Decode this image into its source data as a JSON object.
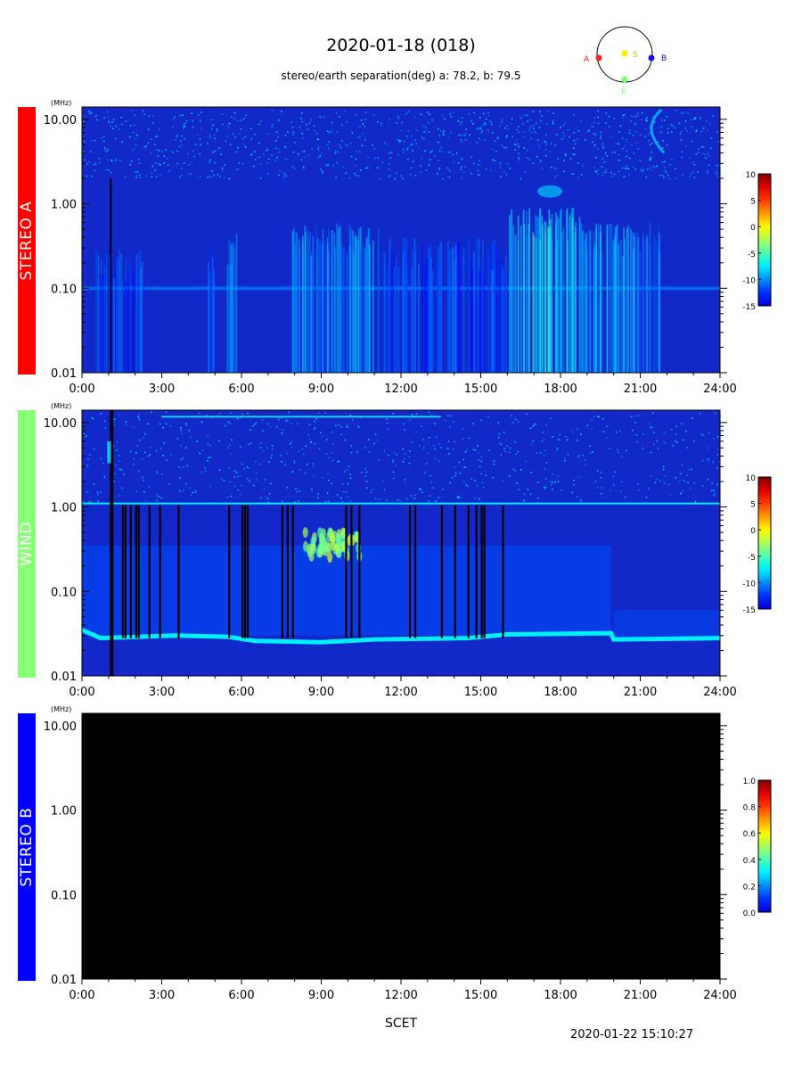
{
  "header": {
    "title": "2020-01-18 (018)",
    "subtitle": "stereo/earth separation(deg) a:  78.2, b:  79.5"
  },
  "orbit_diagram": {
    "labels": {
      "a": "A",
      "s": "S",
      "b": "B",
      "e": "E"
    },
    "colors": {
      "a": "#ff2020",
      "s": "#ffee00",
      "b": "#1010ff",
      "e": "#7dfa7d"
    }
  },
  "footer": {
    "xlabel": "SCET",
    "generated": "2020-01-22 15:10:27"
  },
  "colors": {
    "stereo_a": "#ff0000",
    "wind": "#88ff77",
    "stereo_b": "#0000ff",
    "background_spectrogram": "#1228c8",
    "no_data": "#000000"
  },
  "chart_data": [
    {
      "type": "heatmap",
      "name": "STEREO A",
      "y_unit": "(MHz)",
      "y_scale": "log",
      "ylim": [
        0.01,
        14
      ],
      "y_ticks": [
        "10.00",
        "1.00",
        "0.10",
        "0.01"
      ],
      "xlim": [
        0,
        24
      ],
      "x_ticks": [
        "0:00",
        "3:00",
        "6:00",
        "9:00",
        "12:00",
        "15:00",
        "18:00",
        "21:00",
        "24:00"
      ],
      "colorbar": {
        "min": -15,
        "max": 10,
        "ticks": [
          "10",
          "5",
          "0",
          "-5",
          "-10",
          "-15"
        ]
      },
      "bursts": [
        {
          "start": 0.5,
          "end": 2.3,
          "fmax": 0.3,
          "level": -8
        },
        {
          "start": 4.7,
          "end": 5.0,
          "fmax": 0.3,
          "level": -8
        },
        {
          "start": 5.4,
          "end": 5.8,
          "fmax": 0.45,
          "level": -6
        },
        {
          "start": 7.9,
          "end": 11.2,
          "fmax": 0.6,
          "level": -6
        },
        {
          "start": 11.2,
          "end": 16.0,
          "fmax": 0.4,
          "level": -8
        },
        {
          "start": 16.0,
          "end": 18.7,
          "fmax": 0.9,
          "level": -4
        },
        {
          "start": 18.7,
          "end": 21.9,
          "fmax": 0.6,
          "level": -6
        }
      ],
      "narrowband_line_mhz": 0.1
    },
    {
      "type": "heatmap",
      "name": "WIND",
      "y_unit": "(MHz)",
      "y_scale": "log",
      "ylim": [
        0.01,
        14
      ],
      "y_ticks": [
        "10.00",
        "1.00",
        "0.10",
        "0.01"
      ],
      "xlim": [
        0,
        24
      ],
      "x_ticks": [
        "0:00",
        "3:00",
        "6:00",
        "9:00",
        "12:00",
        "15:00",
        "18:00",
        "21:00",
        "24:00"
      ],
      "colorbar": {
        "min": -15,
        "max": 10,
        "ticks": [
          "10",
          "5",
          "0",
          "-5",
          "-10",
          "-15"
        ]
      },
      "plasma_line": [
        [
          0,
          0.035
        ],
        [
          0.7,
          0.028
        ],
        [
          3.5,
          0.03
        ],
        [
          5.5,
          0.029
        ],
        [
          6.5,
          0.026
        ],
        [
          9,
          0.025
        ],
        [
          11,
          0.027
        ],
        [
          14.5,
          0.028
        ],
        [
          16,
          0.031
        ],
        [
          19.9,
          0.032
        ],
        [
          20,
          0.027
        ],
        [
          24,
          0.028
        ]
      ],
      "gaps_hours": [
        1.1,
        1.5,
        1.6,
        1.8,
        2.0,
        2.1,
        2.5,
        2.9,
        3.6,
        5.5,
        6.0,
        6.1,
        6.2,
        7.5,
        7.7,
        7.9,
        9.9,
        10.1,
        10.4,
        12.3,
        12.5,
        13.5,
        14.0,
        14.5,
        14.8,
        15.0,
        15.1,
        15.8
      ],
      "burst_patch": {
        "start": 8.4,
        "end": 10.5,
        "fmin": 0.25,
        "fmax": 0.5
      }
    },
    {
      "type": "heatmap",
      "name": "STEREO B",
      "y_unit": "(MHz)",
      "y_scale": "log",
      "ylim": [
        0.01,
        14
      ],
      "y_ticks": [
        "10.00",
        "1.00",
        "0.10",
        "0.01"
      ],
      "xlim": [
        0,
        24
      ],
      "x_ticks": [
        "0:00",
        "3:00",
        "6:00",
        "9:00",
        "12:00",
        "15:00",
        "18:00",
        "21:00",
        "24:00"
      ],
      "colorbar": {
        "min": 0.0,
        "max": 1.0,
        "ticks": [
          "1.0",
          "0.8",
          "0.6",
          "0.4",
          "0.2",
          "0.0"
        ]
      },
      "no_data": true
    }
  ]
}
